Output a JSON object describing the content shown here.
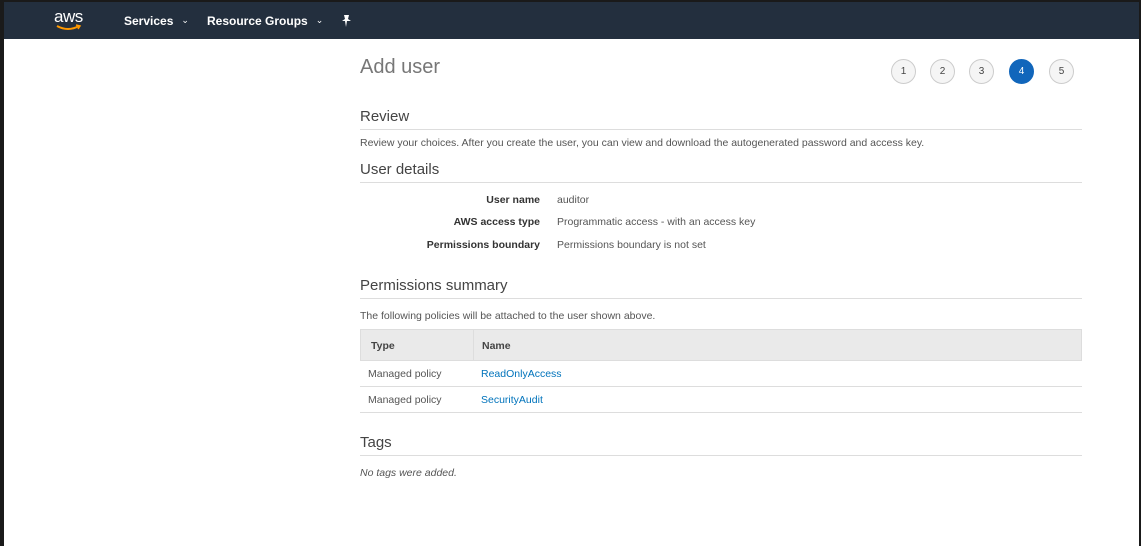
{
  "header": {
    "logo_text": "aws",
    "nav": [
      {
        "label": "Services"
      },
      {
        "label": "Resource Groups"
      }
    ]
  },
  "wizard": {
    "title": "Add user",
    "steps": [
      "1",
      "2",
      "3",
      "4",
      "5"
    ],
    "current_step": 4
  },
  "review": {
    "title": "Review",
    "description": "Review your choices. After you create the user, you can view and download the autogenerated password and access key."
  },
  "user_details": {
    "title": "User details",
    "fields": [
      {
        "label": "User name",
        "value": "auditor"
      },
      {
        "label": "AWS access type",
        "value": "Programmatic access - with an access key"
      },
      {
        "label": "Permissions boundary",
        "value": "Permissions boundary is not set"
      }
    ]
  },
  "permissions": {
    "title": "Permissions summary",
    "description": "The following policies will be attached to the user shown above.",
    "columns": [
      "Type",
      "Name"
    ],
    "rows": [
      {
        "type": "Managed policy",
        "name": "ReadOnlyAccess"
      },
      {
        "type": "Managed policy",
        "name": "SecurityAudit"
      }
    ]
  },
  "tags": {
    "title": "Tags",
    "empty_text": "No tags were added."
  },
  "colors": {
    "topbar": "#232f3e",
    "accent": "#1166bb",
    "link": "#0073bb"
  }
}
